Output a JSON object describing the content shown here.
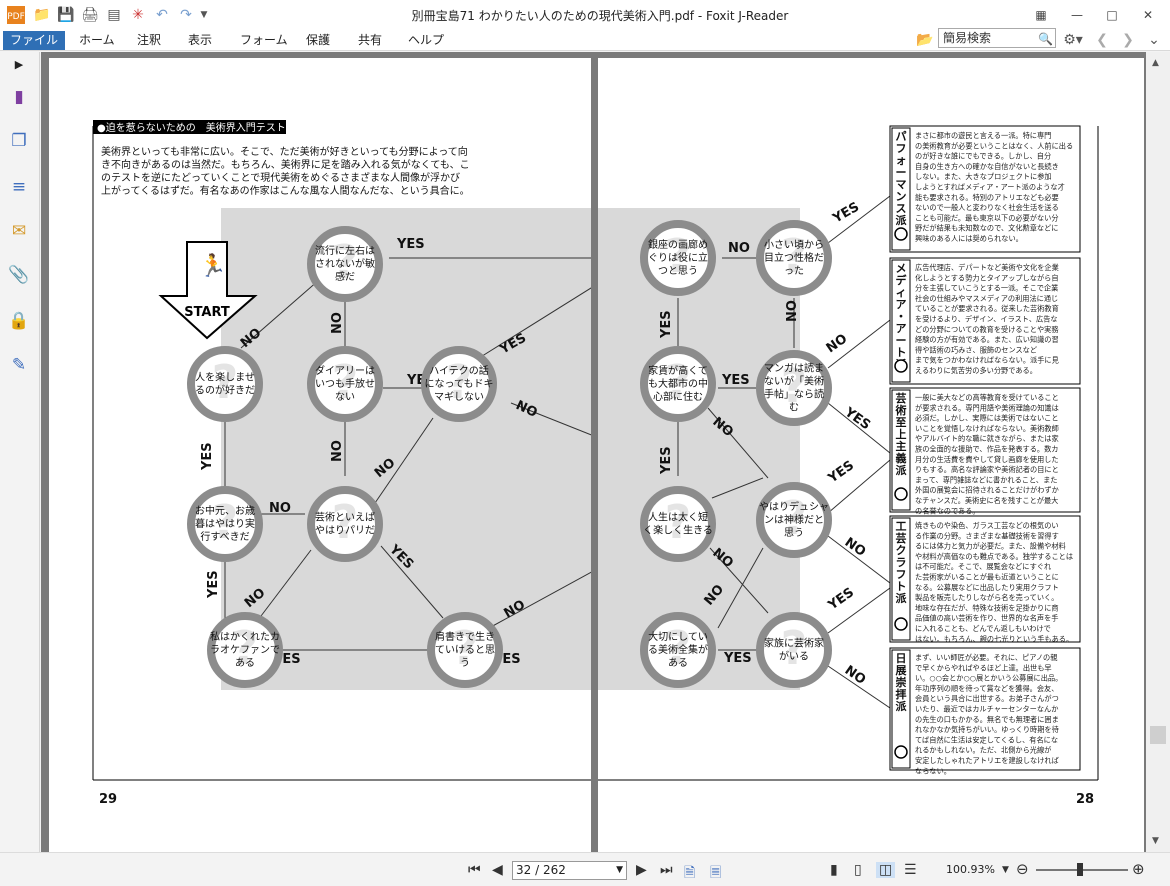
{
  "window": {
    "title": "別冊宝島71 わかりたい人のための現代美術入門.pdf - Foxit J-Reader"
  },
  "menus": [
    "ファイル",
    "ホーム",
    "注釈",
    "表示",
    "フォーム",
    "保護",
    "共有",
    "ヘルプ"
  ],
  "search": {
    "placeholder": "簡易検索"
  },
  "status": {
    "page_indicator": "32 / 262",
    "zoom": "100.93%"
  },
  "left_page": {
    "header_tag": "●迫を惹らないための　美術界入門テスト",
    "intro": [
      "美術界といっても非常に広い。そこで、ただ美術が好きといっても分野によって向",
      "き不向きがあるのは当然だ。もちろん、美術界に足を踏み入れる気がなくても、こ",
      "のテストを逆にたどっていくことで現代美術をめぐるさまざまな人間像が浮かび",
      "上がってくるはずだ。有名なあの作家はこんな風な人間なんだな、という具合に。"
    ],
    "start": "START",
    "page_number": "29",
    "nodes": [
      [
        "人を楽しませ",
        "るのが好きだ"
      ],
      [
        "流行に左右は",
        "されないが敏",
        "感だ"
      ],
      [
        "ダイアリーは",
        "いつも手放せ",
        "ない"
      ],
      [
        "ハイテクの話",
        "になってもドキ",
        "マギしない"
      ],
      [
        "お中元、お歳",
        "暮はやはり実",
        "行すべきだ"
      ],
      [
        "芸術といえば",
        "やはりパリだ"
      ],
      [
        "私はかくれたカ",
        "ラオケファンで",
        "ある"
      ],
      [
        "肩書きで生き",
        "ていけると思",
        "う"
      ]
    ]
  },
  "right_page": {
    "page_number": "28",
    "nodes": [
      [
        "銀座の画廊め",
        "ぐりは役に立",
        "つと思う"
      ],
      [
        "小さい頃から",
        "目立つ性格だ",
        "った"
      ],
      [
        "家賃が高くて",
        "も大都市の中",
        "心部に住む"
      ],
      [
        "マンガは読ま",
        "ないが「美術",
        "手帖」なら読",
        "む"
      ],
      [
        "人生は太く短",
        "く楽しく生きる"
      ],
      [
        "やはりデュシャ",
        "ンは神様だと",
        "思う"
      ],
      [
        "大切にしてい",
        "る美術全集が",
        "ある"
      ],
      [
        "家族に芸術家",
        "がいる"
      ]
    ],
    "categories": [
      {
        "name": "パフォーマンス派",
        "text": [
          "まさに都市の遊民と言える一派。特に専門",
          "の美術教育が必要ということはなく、人前に出る",
          "のが好きな誰にでもできる。しかし、自分",
          "自身の生き方への確かな自信がないと長続き",
          "しない。また、大きなプロジェクトに参加",
          "しようとすればメディア・アート派のような才",
          "能も要求される。特別のアトリエなども必要",
          "ないので一般人と変わりなく社会生活を送る",
          "ことも可能だ。最も東京以下の必要がない分",
          "野だが結果も未知数なので、文化勲章などに",
          "興味のある人には奨められない。"
        ]
      },
      {
        "name": "メディア・アート派",
        "text": [
          "広告代理店、デパートなど美術や文化を企業",
          "化しようとする勢力とタイアップしながら自",
          "分を主張していこうとする一派。そこで企業",
          "社会の仕組みやマスメディアの利用法に通じ",
          "ていることが要求される。従来した芸術教育",
          "を受けるより、デザイン、イラスト、広告な",
          "どの分野についての教育を受けることや実務",
          "経験の方が有効である。また、広い知識の習",
          "得や話術の巧みさ、服飾のセンスなど",
          "まで気をつかわなければならない。派手に見",
          "えるわりに気苦労の多い分野である。"
        ]
      },
      {
        "name": "芸術至上主義派",
        "text": [
          "一般に美大などの高等教育を受けていること",
          "が要求される。専門用語や美術理論の知識は",
          "必須だ。しかし、実際には美術ではないこと",
          "いことを覚悟しなければならない。美術教師",
          "やアルバイト的な職に就きながら、または家",
          "族の全面的な援助で、作品を発表する。数カ",
          "月分の生活費を費やして貸し画廊を使用した",
          "りもする。高名な評論家や美術記者の目にと",
          "まって、専門雑誌などに書かれること、また",
          "外国の展覧会に招待されることだけがわずか",
          "なチャンスだ。美術史に名を残すことが最大",
          "の名誉なのである。"
        ]
      },
      {
        "name": "工芸クラフト派",
        "text": [
          "焼きものや染色、ガラス工芸などの根気のい",
          "る作業の分野。さまざまな基礎技術を習得す",
          "るには体力と気力が必要だ。また、設備や材料",
          "や材料が高価なのも難点である。独学することは",
          "は不可能だ。そこで、展覧会などにすぐれ",
          "た芸術家がいることが最も近道ということに",
          "なる。公募展などに出品したり実用クラフト",
          "製品を販売したりしながら名を売っていく。",
          "地味な存在だが、特殊な技術を足掛かりに商",
          "品価値の高い芸術を作り、世界的な名声を手",
          "に入れることも、どんでん返しもいわけで",
          "はない。もちろん、親の七光りという手もある。"
        ]
      },
      {
        "name": "日展崇拝派",
        "text": [
          "まず、いい師匠が必要。それに、ピアノの親",
          "で早くからやればやるほど上達。出世も早",
          "い。○○会とか○○展とかいう公募展に出品。",
          "年功序列の順を待って賞などを獲得。会友、",
          "会員という具合に出世する。お弟子さんがつ",
          "いたり、最近ではカルチャーセンターなんか",
          "の先生の口もかかる。無名でも無理者に囲ま",
          "れなかなか気持ちがいい。ゆっくり時期を待",
          "てば自然に生活は安定してくるし、有名にな",
          "れるかもしれない。ただ、北側から光線が",
          "安定したしゃれたアトリエを建設しなければ",
          "ならない。"
        ]
      }
    ]
  },
  "arrow_labels": {
    "yes": "YES",
    "no": "NO"
  }
}
